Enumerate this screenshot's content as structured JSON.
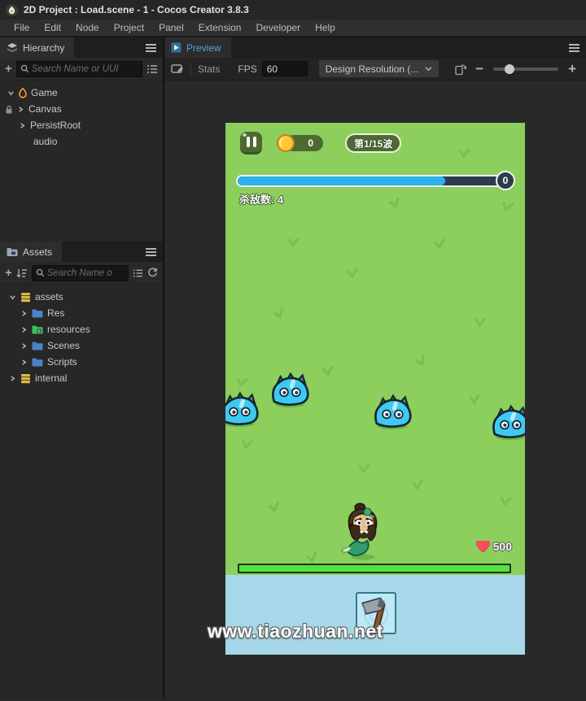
{
  "window": {
    "title": "2D Project : Load.scene - 1 - Cocos Creator 3.8.3"
  },
  "menu": {
    "items": [
      "File",
      "Edit",
      "Node",
      "Project",
      "Panel",
      "Extension",
      "Developer",
      "Help"
    ]
  },
  "hierarchy": {
    "tab_label": "Hierarchy",
    "search_placeholder": "Search Name or UUI",
    "nodes": [
      {
        "label": "Game"
      },
      {
        "label": "Canvas"
      },
      {
        "label": "PersistRoot"
      },
      {
        "label": "audio"
      }
    ]
  },
  "assets": {
    "tab_label": "Assets",
    "search_placeholder": "Search Name o",
    "nodes": [
      {
        "label": "assets"
      },
      {
        "label": "Res"
      },
      {
        "label": "resources"
      },
      {
        "label": "Scenes"
      },
      {
        "label": "Scripts"
      },
      {
        "label": "internal"
      }
    ]
  },
  "preview": {
    "tab_label": "Preview",
    "stats_label": "Stats",
    "fps_label": "FPS",
    "fps_value": "60",
    "resolution_dropdown": "Design Resolution (..."
  },
  "game": {
    "coin_count": "0",
    "wave_label": "第1/15波",
    "progress_badge": "0",
    "kill_count": "杀敌数:  4",
    "hp_value": "500",
    "watermark": "www.tiaozhuan.net",
    "colors": {
      "field_green": "#8ccf5c",
      "sky_blue": "#a6d8e9",
      "hud_green": "#4e6a32",
      "progress_blue": "#2bb3ec",
      "health_green": "#52e23e",
      "coin_gold": "#ffc933",
      "heart_red": "#ff4d5e"
    }
  }
}
